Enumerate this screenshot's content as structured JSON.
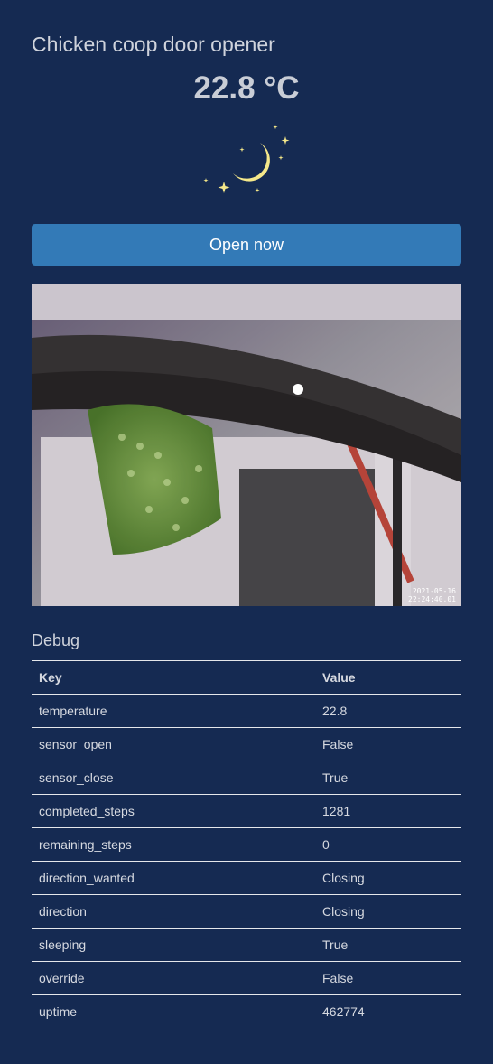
{
  "header": {
    "title": "Chicken coop door opener",
    "temperature_display": "22.8 °C"
  },
  "status_icon": "crescent-moon-with-stars-icon",
  "actions": {
    "open_label": "Open now"
  },
  "camera": {
    "timestamp_line1": "2021-05-16",
    "timestamp_line2": "22:24:40.01"
  },
  "debug": {
    "heading": "Debug",
    "columns": [
      "Key",
      "Value"
    ],
    "rows": [
      {
        "key": "temperature",
        "value": "22.8"
      },
      {
        "key": "sensor_open",
        "value": "False"
      },
      {
        "key": "sensor_close",
        "value": "True"
      },
      {
        "key": "completed_steps",
        "value": "1281"
      },
      {
        "key": "remaining_steps",
        "value": "0"
      },
      {
        "key": "direction_wanted",
        "value": "Closing"
      },
      {
        "key": "direction",
        "value": "Closing"
      },
      {
        "key": "sleeping",
        "value": "True"
      },
      {
        "key": "override",
        "value": "False"
      },
      {
        "key": "uptime",
        "value": "462774"
      }
    ]
  },
  "colors": {
    "background": "#152a52",
    "button": "#337ab7",
    "moon": "#f5e88a"
  }
}
